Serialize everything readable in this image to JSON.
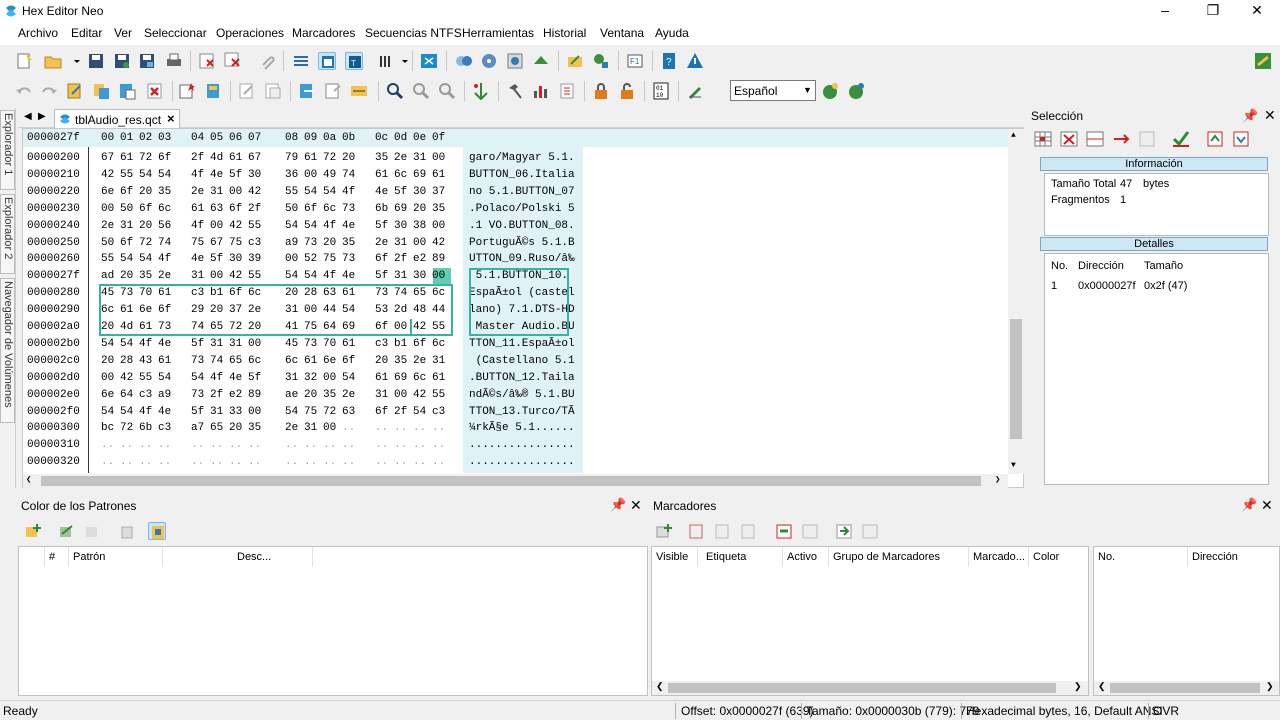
{
  "app": {
    "title": "Hex Editor Neo"
  },
  "menu": [
    "Archivo",
    "Editar",
    "Ver",
    "Seleccionar",
    "Operaciones",
    "Marcadores",
    "Secuencias NTFS",
    "Herramientas",
    "Historial",
    "Ventana",
    "Ayuda"
  ],
  "toolbar": {
    "language": "Español"
  },
  "side_tabs": [
    "Explorador 1",
    "Explorador 2",
    "Navegador de Volúmenes"
  ],
  "document": {
    "tab_label": "tblAudio_res.qct"
  },
  "hex": {
    "header_offset": "0000027f",
    "header_cols": [
      "00",
      "01",
      "02",
      "03",
      "04",
      "05",
      "06",
      "07",
      "08",
      "09",
      "0a",
      "0b",
      "0c",
      "0d",
      "0e",
      "0f"
    ],
    "rows": [
      {
        "off": "00000200",
        "bytes": [
          "67",
          "61",
          "72",
          "6f",
          "2f",
          "4d",
          "61",
          "67",
          "79",
          "61",
          "72",
          "20",
          "35",
          "2e",
          "31",
          "00"
        ],
        "text": "garo/Magyar 5.1."
      },
      {
        "off": "00000210",
        "bytes": [
          "42",
          "55",
          "54",
          "54",
          "4f",
          "4e",
          "5f",
          "30",
          "36",
          "00",
          "49",
          "74",
          "61",
          "6c",
          "69",
          "61"
        ],
        "text": "BUTTON_06.Italia"
      },
      {
        "off": "00000220",
        "bytes": [
          "6e",
          "6f",
          "20",
          "35",
          "2e",
          "31",
          "00",
          "42",
          "55",
          "54",
          "54",
          "4f",
          "4e",
          "5f",
          "30",
          "37"
        ],
        "text": "no 5.1.BUTTON_07"
      },
      {
        "off": "00000230",
        "bytes": [
          "00",
          "50",
          "6f",
          "6c",
          "61",
          "63",
          "6f",
          "2f",
          "50",
          "6f",
          "6c",
          "73",
          "6b",
          "69",
          "20",
          "35"
        ],
        "text": ".Polaco/Polski 5"
      },
      {
        "off": "00000240",
        "bytes": [
          "2e",
          "31",
          "20",
          "56",
          "4f",
          "00",
          "42",
          "55",
          "54",
          "54",
          "4f",
          "4e",
          "5f",
          "30",
          "38",
          "00"
        ],
        "text": ".1 VO.BUTTON_08."
      },
      {
        "off": "00000250",
        "bytes": [
          "50",
          "6f",
          "72",
          "74",
          "75",
          "67",
          "75",
          "c3",
          "a9",
          "73",
          "20",
          "35",
          "2e",
          "31",
          "00",
          "42"
        ],
        "text": "PortuguÃ©s 5.1.B"
      },
      {
        "off": "00000260",
        "bytes": [
          "55",
          "54",
          "54",
          "4f",
          "4e",
          "5f",
          "30",
          "39",
          "00",
          "52",
          "75",
          "73",
          "6f",
          "2f",
          "e2",
          "89"
        ],
        "text": "UTTON_09.Ruso/â‰"
      },
      {
        "off": "0000027f",
        "bytes": [
          "ad",
          "20",
          "35",
          "2e",
          "31",
          "00",
          "42",
          "55",
          "54",
          "54",
          "4f",
          "4e",
          "5f",
          "31",
          "30",
          "00"
        ],
        "text": "­ 5.1.BUTTON_10."
      },
      {
        "off": "00000280",
        "bytes": [
          "45",
          "73",
          "70",
          "61",
          "c3",
          "b1",
          "6f",
          "6c",
          "20",
          "28",
          "63",
          "61",
          "73",
          "74",
          "65",
          "6c"
        ],
        "text": "EspaÃ±ol (castel"
      },
      {
        "off": "00000290",
        "bytes": [
          "6c",
          "61",
          "6e",
          "6f",
          "29",
          "20",
          "37",
          "2e",
          "31",
          "00",
          "44",
          "54",
          "53",
          "2d",
          "48",
          "44"
        ],
        "text": "lano) 7.1.DTS-HD"
      },
      {
        "off": "000002a0",
        "bytes": [
          "20",
          "4d",
          "61",
          "73",
          "74",
          "65",
          "72",
          "20",
          "41",
          "75",
          "64",
          "69",
          "6f",
          "00",
          "42",
          "55"
        ],
        "text": " Master Audio.BU"
      },
      {
        "off": "000002b0",
        "bytes": [
          "54",
          "54",
          "4f",
          "4e",
          "5f",
          "31",
          "31",
          "00",
          "45",
          "73",
          "70",
          "61",
          "c3",
          "b1",
          "6f",
          "6c"
        ],
        "text": "TTON_11.EspaÃ±ol"
      },
      {
        "off": "000002c0",
        "bytes": [
          "20",
          "28",
          "43",
          "61",
          "73",
          "74",
          "65",
          "6c",
          "6c",
          "61",
          "6e",
          "6f",
          "20",
          "35",
          "2e",
          "31"
        ],
        "text": " (Castellano 5.1"
      },
      {
        "off": "000002d0",
        "bytes": [
          "00",
          "42",
          "55",
          "54",
          "54",
          "4f",
          "4e",
          "5f",
          "31",
          "32",
          "00",
          "54",
          "61",
          "69",
          "6c",
          "61"
        ],
        "text": ".BUTTON_12.Taila"
      },
      {
        "off": "000002e0",
        "bytes": [
          "6e",
          "64",
          "c3",
          "a9",
          "73",
          "2f",
          "e2",
          "89",
          "ae",
          "20",
          "35",
          "2e",
          "31",
          "00",
          "42",
          "55"
        ],
        "text": "ndÃ©s/â‰® 5.1.BU"
      },
      {
        "off": "000002f0",
        "bytes": [
          "54",
          "54",
          "4f",
          "4e",
          "5f",
          "31",
          "33",
          "00",
          "54",
          "75",
          "72",
          "63",
          "6f",
          "2f",
          "54",
          "c3"
        ],
        "text": "TTON_13.Turco/TÃ"
      },
      {
        "off": "00000300",
        "bytes": [
          "bc",
          "72",
          "6b",
          "c3",
          "a7",
          "65",
          "20",
          "35",
          "2e",
          "31",
          "00",
          "..",
          "..",
          "..",
          "..",
          ".."
        ],
        "text": "¼rkÃ§e 5.1......"
      },
      {
        "off": "00000310",
        "bytes": [
          "..",
          "..",
          "..",
          "..",
          "..",
          "..",
          "..",
          "..",
          "..",
          "..",
          "..",
          "..",
          "..",
          "..",
          "..",
          ".."
        ],
        "text": "................"
      },
      {
        "off": "00000320",
        "bytes": [
          "..",
          "..",
          "..",
          "..",
          "..",
          "..",
          "..",
          "..",
          "..",
          "..",
          "..",
          "..",
          "..",
          "..",
          "..",
          ".."
        ],
        "text": "................"
      }
    ]
  },
  "selection_panel": {
    "title": "Selección",
    "info_header": "Información",
    "info": [
      {
        "label": "Tamaño Total",
        "value": "47",
        "unit": "bytes"
      },
      {
        "label": "Fragmentos",
        "value": "1",
        "unit": ""
      }
    ],
    "details_header": "Detalles",
    "details_cols": [
      "No.",
      "Dirección",
      "Tamaño"
    ],
    "details_rows": [
      {
        "no": "1",
        "addr": "0x0000027f",
        "size": "0x2f (47)"
      }
    ]
  },
  "patterns_panel": {
    "title": "Color de los Patrones",
    "cols": [
      "#",
      "Patrón",
      "Desc..."
    ]
  },
  "bookmarks_panel": {
    "title": "Marcadores",
    "cols": [
      "Visible",
      "Etiqueta",
      "Activo",
      "Grupo de Marcadores",
      "Marcado...",
      "Color"
    ],
    "right_cols": [
      "No.",
      "Dirección"
    ]
  },
  "status": {
    "ready": "Ready",
    "offset": "Offset: 0x0000027f (639)",
    "size": "Tamaño: 0x0000030b (779): 779",
    "mode": "Hexadecimal bytes, 16, Default ANSI",
    "ovr": "OVR"
  }
}
